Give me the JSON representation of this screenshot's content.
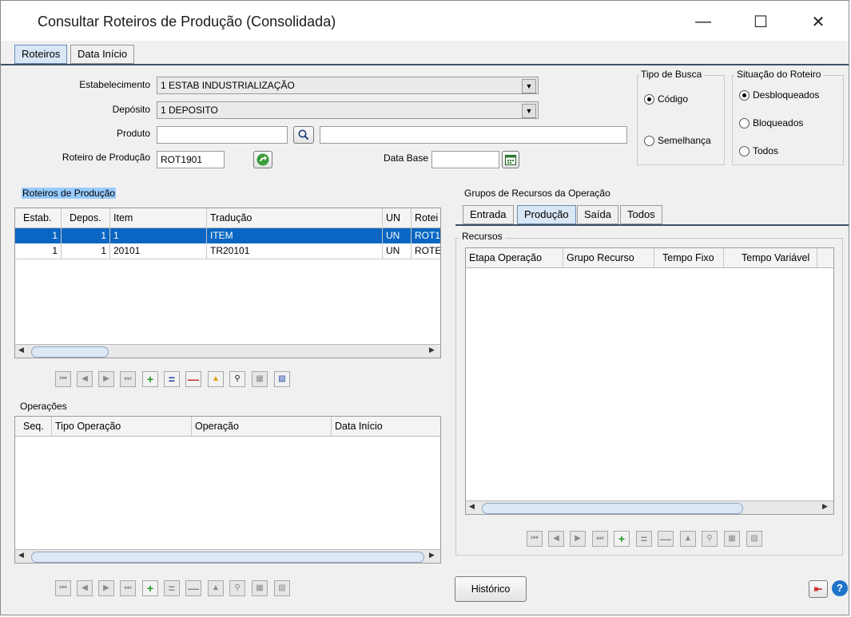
{
  "window": {
    "title": "Consultar Roteiros de Produção (Consolidada)"
  },
  "top_tabs": [
    "Roteiros",
    "Data Início"
  ],
  "form": {
    "estabelecimento_label": "Estabelecimento",
    "estabelecimento_value": "1 ESTAB INDUSTRIALIZAÇÃO",
    "deposito_label": "Depósito",
    "deposito_value": "1 DEPOSITO",
    "produto_label": "Produto",
    "produto_value": "",
    "produto_desc": "",
    "roteiro_label": "Roteiro de Produção",
    "roteiro_value": "ROT1901",
    "data_base_label": "Data Base",
    "data_base_value": ""
  },
  "tipo_busca": {
    "title": "Tipo de Busca",
    "options": [
      "Código",
      "Semelhança"
    ],
    "selected": "Código"
  },
  "situacao": {
    "title": "Situação do Roteiro",
    "options": [
      "Desbloqueados",
      "Bloqueados",
      "Todos"
    ],
    "selected": "Desbloqueados"
  },
  "roteiros": {
    "title": "Roteiros de Produção",
    "columns": [
      "Estab.",
      "Depos.",
      "Item",
      "Tradução",
      "UN",
      "Rotei"
    ],
    "rows": [
      [
        "1",
        "1",
        "1",
        "ITEM",
        "UN",
        "ROT1"
      ],
      [
        "1",
        "1",
        "20101",
        "TR20101",
        "UN",
        "ROTE"
      ]
    ]
  },
  "operacoes": {
    "title": "Operações",
    "columns": [
      "Seq.",
      "Tipo Operação",
      "Operação",
      "Data Início"
    ]
  },
  "grupos": {
    "title": "Grupos de Recursos da Operação",
    "tabs": [
      "Entrada",
      "Produção",
      "Saída",
      "Todos"
    ],
    "active_tab": "Produção",
    "recursos_title": "Recursos",
    "columns": [
      "Etapa Operação",
      "Grupo Recurso",
      "Tempo Fixo",
      "Tempo Variável"
    ]
  },
  "buttons": {
    "historico": "Histórico"
  },
  "icons": {
    "minimize": "minimize-icon",
    "maximize": "maximize-icon",
    "close": "close-icon",
    "search": "magnifier-icon",
    "refresh": "green-arrow-icon",
    "calendar": "calendar-icon",
    "exit": "exit-icon",
    "help": "help-icon"
  },
  "colors": {
    "selection": "#0a66c2",
    "highlight_label": "#99ccff",
    "tab_active": "#d9e6f5"
  }
}
